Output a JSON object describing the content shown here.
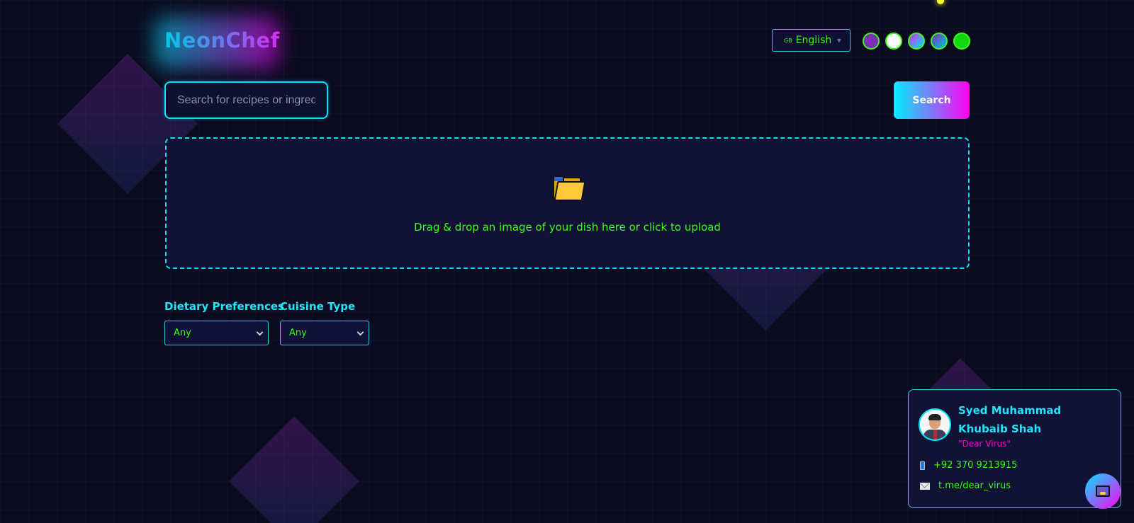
{
  "header": {
    "logo_text": "NeonChef",
    "language": {
      "flag": "GB",
      "selected": "English"
    },
    "theme_swatches": [
      "#7b2fb6",
      "#ffffff",
      "gradient-magenta-cyan",
      "gradient-purple-cyan",
      "#12d612"
    ]
  },
  "search": {
    "placeholder": "Search for recipes or ingredients...",
    "value": "",
    "button_label": "Search"
  },
  "upload": {
    "icon": "folder-icon",
    "text": "Drag & drop an image of your dish here or click to upload"
  },
  "filters": {
    "dietary": {
      "label": "Dietary Preferences",
      "selected": "Any"
    },
    "cuisine": {
      "label": "Cuisine Type",
      "selected": "Any"
    }
  },
  "contact_card": {
    "name": "Syed Muhammad Khubaib Shah",
    "nickname": "\"Dear Virus\"",
    "phone": "+92 370 9213915",
    "telegram": "t.me/dear_virus"
  },
  "colors": {
    "background": "#0a0b1e",
    "accent_cyan": "#00e5ff",
    "accent_magenta": "#ff00f0",
    "text_green": "#39ff14"
  }
}
